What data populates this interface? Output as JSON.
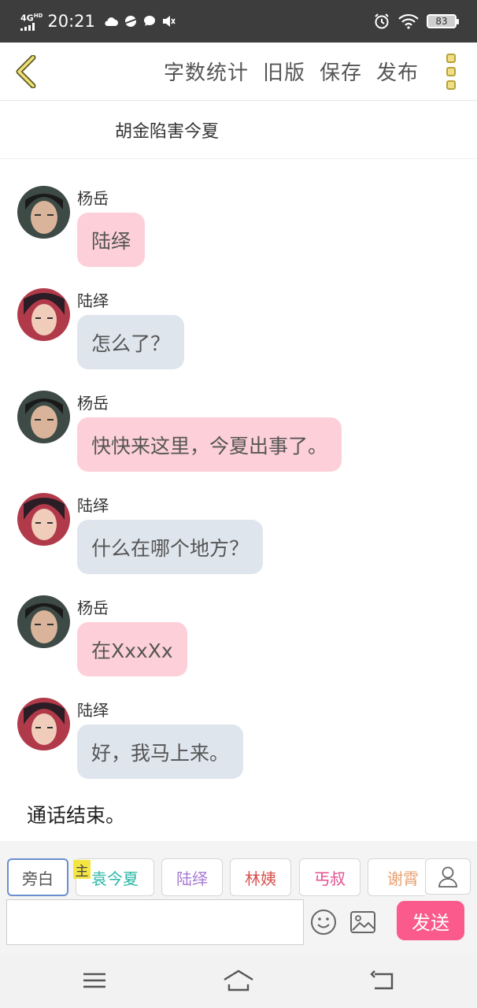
{
  "status_bar": {
    "network": "4G",
    "network_sup": "HD",
    "time": "20:21",
    "battery": "83"
  },
  "header": {
    "actions": [
      "字数统计",
      "旧版",
      "保存",
      "发布"
    ]
  },
  "story": {
    "title": "胡金陷害今夏"
  },
  "messages": [
    {
      "sender": "杨岳",
      "text": "陆绎",
      "style": "pink"
    },
    {
      "sender": "陆绎",
      "text": "怎么了？",
      "style": "blue"
    },
    {
      "sender": "杨岳",
      "text": "快快来这里，今夏出事了。",
      "style": "pink"
    },
    {
      "sender": "陆绎",
      "text": "什么在哪个地方？",
      "style": "blue"
    },
    {
      "sender": "杨岳",
      "text": "在XxxXx",
      "style": "pink"
    },
    {
      "sender": "陆绎",
      "text": "好，我马上来。",
      "style": "blue"
    }
  ],
  "narration": "通话结束。",
  "roles": [
    {
      "label": "旁白",
      "color": "#555555"
    },
    {
      "label": "袁今夏",
      "color": "#2bb7a6"
    },
    {
      "label": "陆绎",
      "color": "#a77ad4"
    },
    {
      "label": "林姨",
      "color": "#d9534f"
    },
    {
      "label": "丐叔",
      "color": "#e0508f"
    },
    {
      "label": "谢霄",
      "color": "#e8a070"
    }
  ],
  "role_badge": "主",
  "composer": {
    "input_value": "",
    "send_label": "发送"
  },
  "colors": {
    "pink_bubble": "#fdd0d9",
    "blue_bubble": "#dfe5ed",
    "send_button": "#fb5a8c",
    "accent_yellow": "#f0df88"
  }
}
